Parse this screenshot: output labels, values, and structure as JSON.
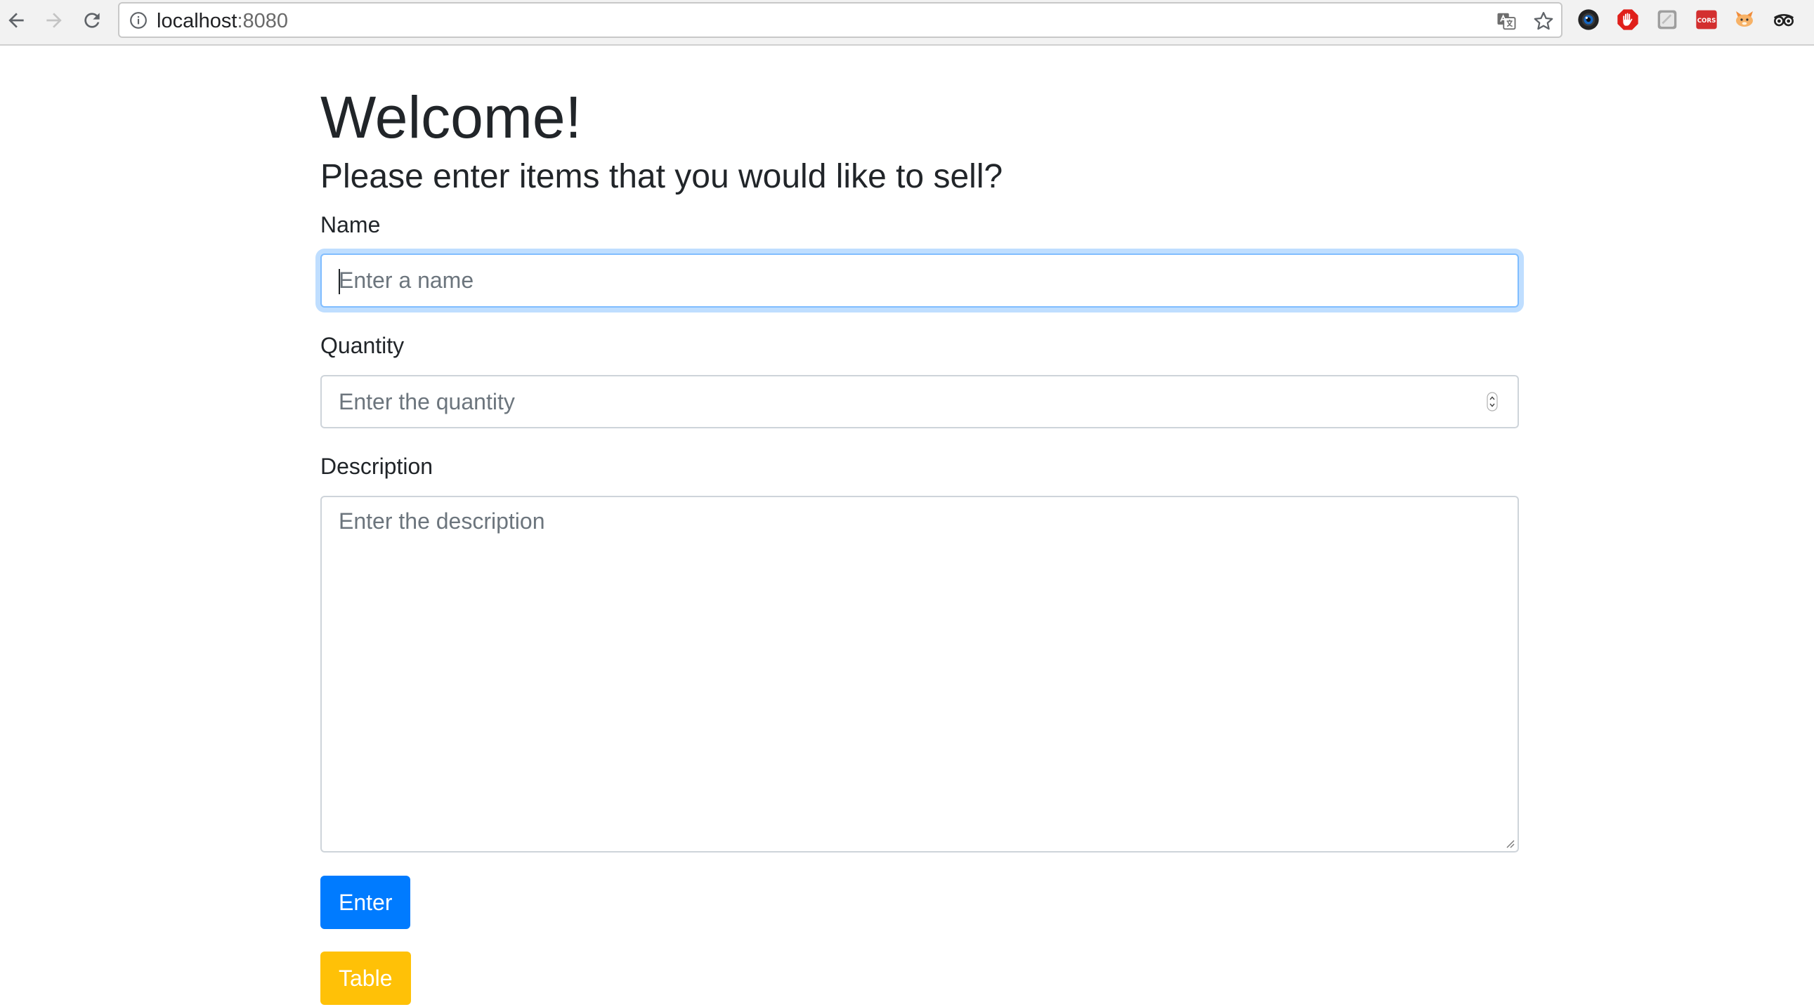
{
  "browser": {
    "url_host": "localhost",
    "url_port": ":8080"
  },
  "page": {
    "title": "Welcome!",
    "subtitle": "Please enter items that you would like to sell?"
  },
  "form": {
    "name_label": "Name",
    "name_placeholder": "Enter a name",
    "quantity_label": "Quantity",
    "quantity_placeholder": "Enter the quantity",
    "description_label": "Description",
    "description_placeholder": "Enter the description",
    "enter_button": "Enter",
    "table_button": "Table"
  },
  "colors": {
    "primary": "#007bff",
    "warning": "#ffc107",
    "focus_border": "#80bdff"
  }
}
